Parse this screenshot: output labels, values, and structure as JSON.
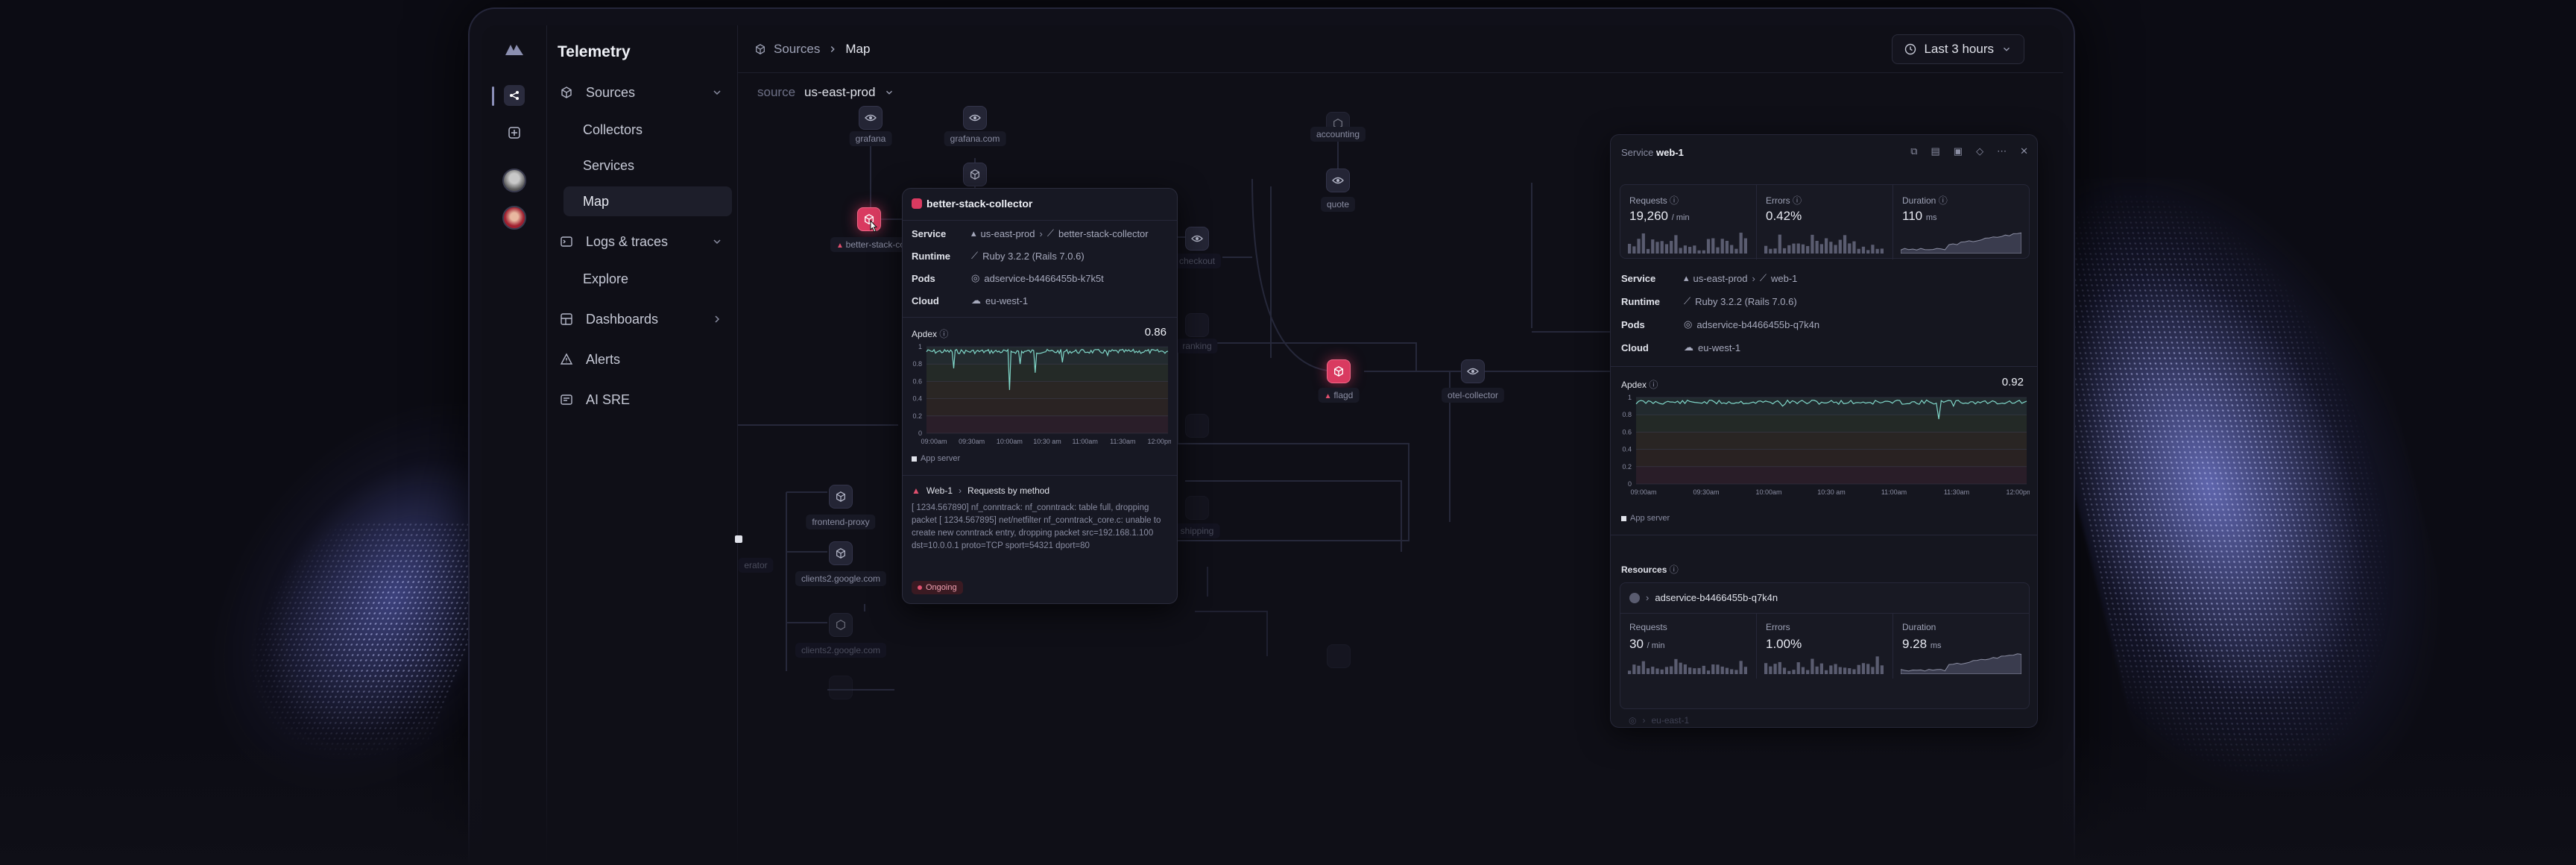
{
  "app": {
    "title": "Telemetry"
  },
  "nav": {
    "sources": "Sources",
    "collectors": "Collectors",
    "services": "Services",
    "map": "Map",
    "logs": "Logs & traces",
    "explore": "Explore",
    "dashboards": "Dashboards",
    "alerts": "Alerts",
    "ai_sre": "AI SRE"
  },
  "breadcrumb": {
    "parent": "Sources",
    "current": "Map"
  },
  "time_range": "Last 3 hours",
  "source_filter": {
    "label": "source",
    "value": "us-east-prod"
  },
  "map_nodes": {
    "grafana": "grafana",
    "grafana_com": "grafana.com",
    "accounting": "accounting",
    "quote": "quote",
    "better_stack": "better-stack-co",
    "flagd": "flagd",
    "otel_collector": "otel-collector",
    "frontend_proxy": "frontend-proxy",
    "clients2": "clients2.google.com",
    "clients2b": "clients2.google.com",
    "generator": "erator",
    "checkout": "checkout",
    "ranking": "ranking",
    "shipping": "shipping"
  },
  "popup": {
    "title": "better-stack-collector",
    "service_label": "Service",
    "service_env": "us-east-prod",
    "service_name": "better-stack-collector",
    "runtime_label": "Runtime",
    "runtime_value": "Ruby 3.2.2 (Rails 7.0.6)",
    "pods_label": "Pods",
    "pods_value": "adservice-b4466455b-k7k5t",
    "cloud_label": "Cloud",
    "cloud_value": "eu-west-1",
    "apdex_label": "Apdex",
    "apdex_value": "0.86",
    "y_ticks": [
      "1",
      "0.8",
      "0.6",
      "0.4",
      "0.2",
      "0"
    ],
    "x_ticks": [
      "09:00am",
      "09:30am",
      "10:00am",
      "10:30 am",
      "11:00am",
      "11:30am",
      "12:00pm"
    ],
    "legend": "App server",
    "alert_source": "Web-1",
    "alert_title": "Requests by method",
    "log_text": "[ 1234.567890] nf_conntrack: nf_conntrack: table full, dropping packet [ 1234.567895] net/netfilter nf_conntrack_core.c: unable to create new conntrack entry, dropping packet src=192.168.1.100 dst=10.0.0.1 proto=TCP sport=54321 dport=80",
    "status": "Ongoing"
  },
  "panel": {
    "title_prefix": "Service",
    "title_name": "web-1",
    "requests_label": "Requests",
    "requests_value": "19,260",
    "requests_unit": "/ min",
    "errors_label": "Errors",
    "errors_value": "0.42%",
    "duration_label": "Duration",
    "duration_value": "110",
    "duration_unit": "ms",
    "service_label": "Service",
    "service_env": "us-east-prod",
    "service_name": "web-1",
    "runtime_label": "Runtime",
    "runtime_value": "Ruby 3.2.2 (Rails 7.0.6)",
    "pods_label": "Pods",
    "pods_value": "adservice-b4466455b-q7k4n",
    "cloud_label": "Cloud",
    "cloud_value": "eu-west-1",
    "apdex_label": "Apdex",
    "apdex_value": "0.92",
    "y_ticks": [
      "1",
      "0.8",
      "0.6",
      "0.4",
      "0.2",
      "0"
    ],
    "x_ticks": [
      "09:00am",
      "09:30am",
      "10:00am",
      "10:30 am",
      "11:00am",
      "11:30am",
      "12:00pm"
    ],
    "legend": "App server",
    "resources_label": "Resources",
    "resource_name": "adservice-b4466455b-q7k4n",
    "res_requests_label": "Requests",
    "res_requests_value": "30",
    "res_requests_unit": "/ min",
    "res_errors_label": "Errors",
    "res_errors_value": "1.00%",
    "res_duration_label": "Duration",
    "res_duration_value": "9.28",
    "res_duration_unit": "ms",
    "next_resource": "eu-east-1"
  },
  "colors": {
    "accent_red": "#d93a60",
    "apdex_line": "#7fd6c8",
    "background": "#0f0f17"
  }
}
